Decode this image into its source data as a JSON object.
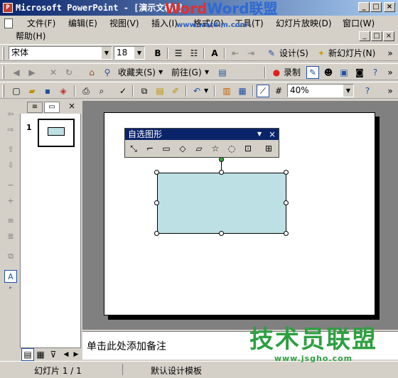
{
  "window": {
    "title": "Microsoft PowerPoint - [演示文稿1]",
    "minimize": "_",
    "restore": "□",
    "close": "×"
  },
  "menu": {
    "items": [
      "文件(F)",
      "编辑(E)",
      "视图(V)",
      "插入(I)",
      "格式(O)",
      "工具(T)",
      "幻灯片放映(D)",
      "窗口(W)"
    ],
    "help": "帮助(H)",
    "doc_min": "_",
    "doc_restore": "□",
    "doc_close": "×"
  },
  "format_toolbar": {
    "font": "宋体",
    "size": "18",
    "bold": "B",
    "design": "设计(S)",
    "new_slide": "新幻灯片(N)"
  },
  "web_toolbar": {
    "favorites": "收藏夹(S)",
    "go": "前往(G)",
    "record": "录制"
  },
  "standard_toolbar": {
    "zoom": "40%"
  },
  "outline_tabs": [
    "≡",
    "▭"
  ],
  "thumbnail": {
    "number": "1"
  },
  "autoshapes_toolbar": {
    "title": "自选图形",
    "icons": [
      "connector-icon",
      "elbow-connector-icon",
      "process-icon",
      "decision-icon",
      "data-icon",
      "star-icon",
      "callout-icon",
      "flowchart-icon",
      "more-icon"
    ]
  },
  "notes": {
    "placeholder": "单击此处添加备注"
  },
  "status": {
    "slide": "幻灯片 1 / 1",
    "template": "默认设计模板"
  },
  "watermark": {
    "top": "Word联盟",
    "url": "www.wordlm.com",
    "bottom_big": "技术员联盟",
    "bottom_url": "www.jsgho.com"
  },
  "colors": {
    "titlebar": "#0a246a",
    "shape_fill": "#bde0e4",
    "canvas": "#808080"
  }
}
